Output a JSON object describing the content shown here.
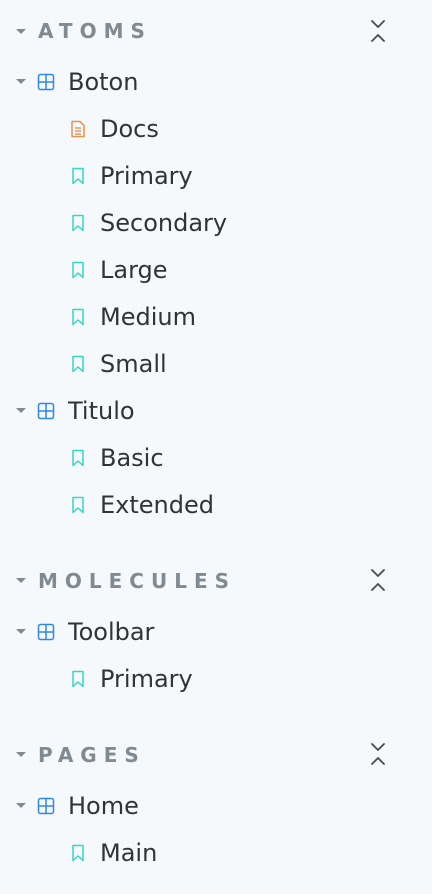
{
  "colors": {
    "section_text": "#7f8a93",
    "component_icon": "#2f89e0",
    "docs_icon": "#e5924a",
    "story_icon": "#37d5c8",
    "item_text": "#333333",
    "background": "#f6f9fc"
  },
  "sections": [
    {
      "title": "ATOMS",
      "components": [
        {
          "label": "Boton",
          "icon": "component-grid-icon",
          "items": [
            {
              "label": "Docs",
              "icon": "document-icon"
            },
            {
              "label": "Primary",
              "icon": "bookmark-icon"
            },
            {
              "label": "Secondary",
              "icon": "bookmark-icon"
            },
            {
              "label": "Large",
              "icon": "bookmark-icon"
            },
            {
              "label": "Medium",
              "icon": "bookmark-icon"
            },
            {
              "label": "Small",
              "icon": "bookmark-icon"
            }
          ]
        },
        {
          "label": "Titulo",
          "icon": "component-grid-icon",
          "items": [
            {
              "label": "Basic",
              "icon": "bookmark-icon"
            },
            {
              "label": "Extended",
              "icon": "bookmark-icon"
            }
          ]
        }
      ]
    },
    {
      "title": "MOLECULES",
      "components": [
        {
          "label": "Toolbar",
          "icon": "component-grid-icon",
          "items": [
            {
              "label": "Primary",
              "icon": "bookmark-icon"
            }
          ]
        }
      ]
    },
    {
      "title": "PAGES",
      "components": [
        {
          "label": "Home",
          "icon": "component-grid-icon",
          "items": [
            {
              "label": "Main",
              "icon": "bookmark-icon"
            }
          ]
        }
      ]
    }
  ]
}
